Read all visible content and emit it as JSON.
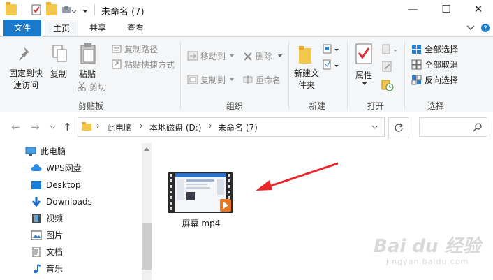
{
  "window": {
    "title": "未命名 (7)",
    "minimize_glyph": "—",
    "maximize_glyph": "☐",
    "close_glyph": "✕"
  },
  "ribbon_tabs": [
    "文件",
    "主页",
    "共享",
    "查看"
  ],
  "ribbon": {
    "clipboard": {
      "pin": "固定到快速访问",
      "copy": "复制",
      "paste": "粘贴",
      "copy_path": "复制路径",
      "paste_shortcut": "粘贴快捷方式",
      "cut": "剪切",
      "label": "剪贴板"
    },
    "organize": {
      "move_to": "移动到",
      "copy_to": "复制到",
      "delete": "删除",
      "rename": "重命名",
      "label": "组织"
    },
    "new": {
      "new_folder": "新建文件夹",
      "label": "新建"
    },
    "open": {
      "properties": "属性",
      "label": "打开"
    },
    "select": {
      "select_all": "全部选择",
      "select_none": "全部取消",
      "invert": "反向选择",
      "label": "选择"
    }
  },
  "address": {
    "crumbs": [
      "此电脑",
      "本地磁盘 (D:)",
      "未命名 (7)"
    ]
  },
  "sidebar": {
    "items": [
      {
        "label": "此电脑",
        "icon": "monitor-icon"
      },
      {
        "label": "WPS网盘",
        "icon": "cloud-icon"
      },
      {
        "label": "Desktop",
        "icon": "desktop-icon"
      },
      {
        "label": "Downloads",
        "icon": "download-arrow-icon"
      },
      {
        "label": "视频",
        "icon": "film-icon"
      },
      {
        "label": "图片",
        "icon": "picture-icon"
      },
      {
        "label": "文档",
        "icon": "document-icon"
      },
      {
        "label": "音乐",
        "icon": "music-note-icon"
      }
    ]
  },
  "files": [
    {
      "name": "屏幕.mp4",
      "type": "video"
    }
  ],
  "watermark": {
    "main": "Bai du 经验",
    "sub": "jingyan.baidu.com"
  },
  "colors": {
    "accent": "#1979ca",
    "folder": "#f3c64c",
    "arrow": "#e8262c"
  }
}
